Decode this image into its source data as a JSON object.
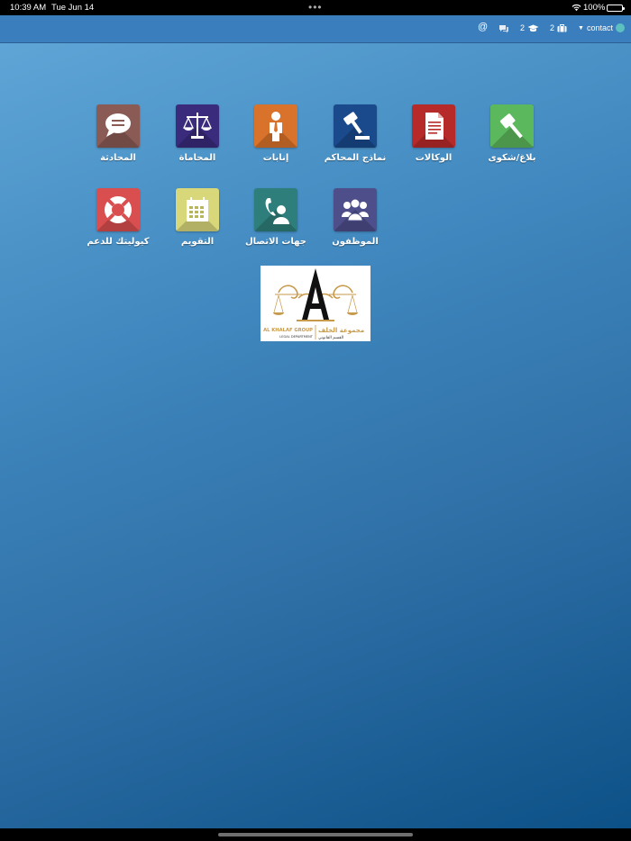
{
  "status_bar": {
    "time": "10:39 AM",
    "date": "Tue Jun 14",
    "battery": "100%"
  },
  "navbar": {
    "at_symbol": "@",
    "graduation_count": "2",
    "briefcase_count": "2",
    "user_label": "contact"
  },
  "apps": [
    {
      "label": "بلاغ/شكوى",
      "icon": "gavel-icon",
      "color": "#5cb85c"
    },
    {
      "label": "الوكالات",
      "icon": "document-icon",
      "color": "#b72a2a"
    },
    {
      "label": "نماذج المحاكم",
      "icon": "gavel-book-icon",
      "color": "#1a4a8c"
    },
    {
      "label": "إنابات",
      "icon": "person-tie-icon",
      "color": "#d9732b"
    },
    {
      "label": "المحاماة",
      "icon": "scales-icon",
      "color": "#3a2b7d"
    },
    {
      "label": "المحادثة",
      "icon": "speech-bubble-icon",
      "color": "#8a5a55"
    },
    {
      "label": "الموظفون",
      "icon": "users-icon",
      "color": "#4e4f8a"
    },
    {
      "label": "جهات الاتصال",
      "icon": "contact-phone-icon",
      "color": "#2e7f7b"
    },
    {
      "label": "التقويم",
      "icon": "calendar-icon",
      "color": "#d8d77a"
    },
    {
      "label": "كيوليتك للدعم",
      "icon": "lifebuoy-icon",
      "color": "#d94f4f"
    }
  ],
  "logo": {
    "english_name": "AL KHALAF GROUP",
    "english_sub": "LEGAL DEPARTMENT",
    "arabic_name": "مجموعة الخلف",
    "arabic_sub": "القسم القانوني"
  }
}
